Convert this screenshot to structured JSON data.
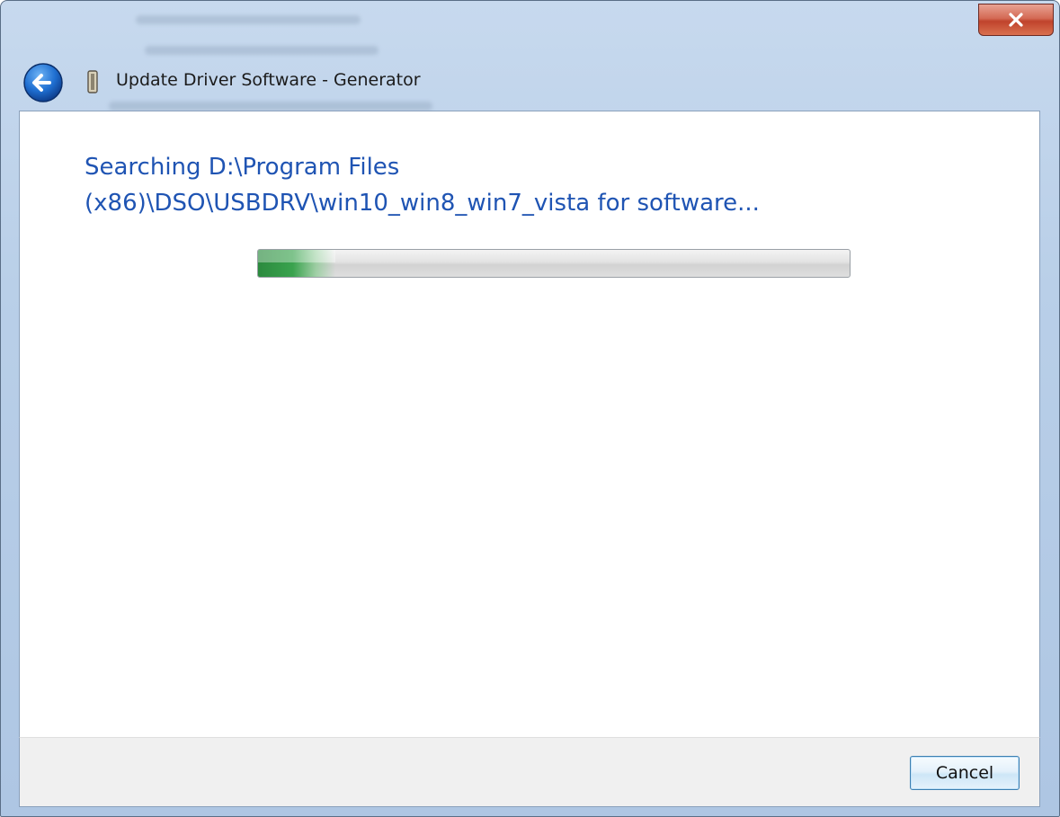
{
  "window": {
    "title": "Update Driver Software - Generator",
    "close_glyph": "✕"
  },
  "content": {
    "heading_line1": "Searching D:\\Program Files",
    "heading_line2": "(x86)\\DSO\\USBDRV\\win10_win8_win7_vista for software..."
  },
  "progress": {
    "fraction": 0.13,
    "color": "#2b8a3e"
  },
  "footer": {
    "cancel_label": "Cancel"
  },
  "icons": {
    "back": "back-arrow-icon",
    "device": "device-icon",
    "close": "close-icon"
  },
  "colors": {
    "heading": "#1f54b3",
    "close_button": "#c0432c",
    "titlebar": "#b9cfe8"
  }
}
